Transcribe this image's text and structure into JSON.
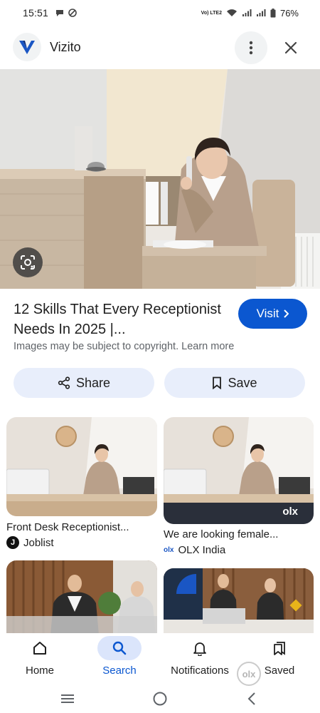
{
  "status_bar": {
    "time": "15:51",
    "network_label": "Vo) LTE2",
    "battery": "76%"
  },
  "header": {
    "site_name": "Vizito"
  },
  "result": {
    "title": "12 Skills That Every Receptionist Needs In 2025 |...",
    "visit_label": "Visit",
    "copyright_note": "Images may be subject to copyright. Learn more",
    "share_label": "Share",
    "save_label": "Save"
  },
  "related": [
    {
      "title": "Front Desk Receptionist...",
      "source": "Joblist"
    },
    {
      "title": "We are looking female...",
      "source": "OLX India",
      "watermark": "olx"
    },
    {
      "title": "",
      "source": ""
    },
    {
      "title": "",
      "source": ""
    }
  ],
  "bottom_nav": {
    "items": [
      {
        "label": "Home",
        "icon": "home-icon"
      },
      {
        "label": "Search",
        "icon": "search-icon",
        "active": true
      },
      {
        "label": "Notifications",
        "icon": "bell-icon"
      },
      {
        "label": "Saved",
        "icon": "bookmark-icon"
      }
    ]
  },
  "overlay_watermark": "olx",
  "colors": {
    "accent": "#0b57d0",
    "button_bg": "#e8eefb",
    "active_pill": "#dbe5fb",
    "muted_text": "#5f6368"
  }
}
